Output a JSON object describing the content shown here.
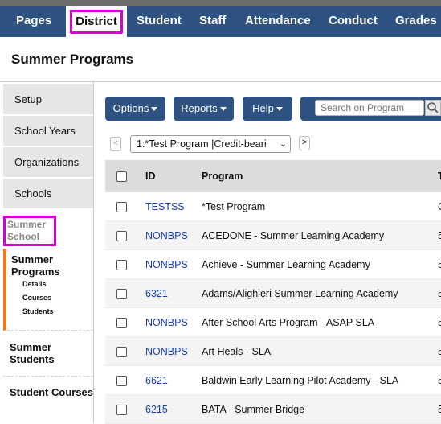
{
  "nav": {
    "tabs": [
      "Pages",
      "District",
      "Student",
      "Staff",
      "Attendance",
      "Conduct",
      "Grades"
    ],
    "active_tab": "District"
  },
  "page": {
    "title": "Summer Programs"
  },
  "sidebar": {
    "items": [
      "Setup",
      "School Years",
      "Organizations",
      "Schools"
    ],
    "section_label": "Summer School",
    "groups": [
      {
        "title": "Summer Programs",
        "subitems": [
          "Details",
          "Courses",
          "Students"
        ]
      },
      {
        "title": "Summer Students",
        "subitems": []
      },
      {
        "title": "Student Courses",
        "subitems": []
      }
    ]
  },
  "toolbar": {
    "options_label": "Options",
    "reports_label": "Reports",
    "help_label": "Help",
    "search_placeholder": "Search on Program"
  },
  "navigator": {
    "prev_label": "<",
    "next_label": ">",
    "selected_record": "1:*Test Program |Credit-beari"
  },
  "table": {
    "columns": [
      "ID",
      "Program",
      "T"
    ],
    "rows": [
      {
        "id": "TESTSS",
        "program": "*Test Program",
        "extra": "C"
      },
      {
        "id": "NONBPS",
        "program": "ACEDONE - Summer Learning Academy",
        "extra": "5"
      },
      {
        "id": "NONBPS",
        "program": "Achieve - Summer Learning Academy",
        "extra": "5"
      },
      {
        "id": "6321",
        "program": "Adams/Alighieri Summer Learning Academy",
        "extra": "5"
      },
      {
        "id": "NONBPS",
        "program": "After School Arts Program - ASAP SLA",
        "extra": "5"
      },
      {
        "id": "NONBPS",
        "program": "Art Heals - SLA",
        "extra": "5"
      },
      {
        "id": "6621",
        "program": "Baldwin Early Learning Pilot Academy - SLA",
        "extra": "5"
      },
      {
        "id": "6215",
        "program": "BATA - Summer Bridge",
        "extra": "5"
      }
    ]
  },
  "colors": {
    "nav_bar": "#2e5382",
    "highlight": "#d400d4",
    "active_marker": "#f07a1e",
    "link": "#1a3fb0"
  }
}
